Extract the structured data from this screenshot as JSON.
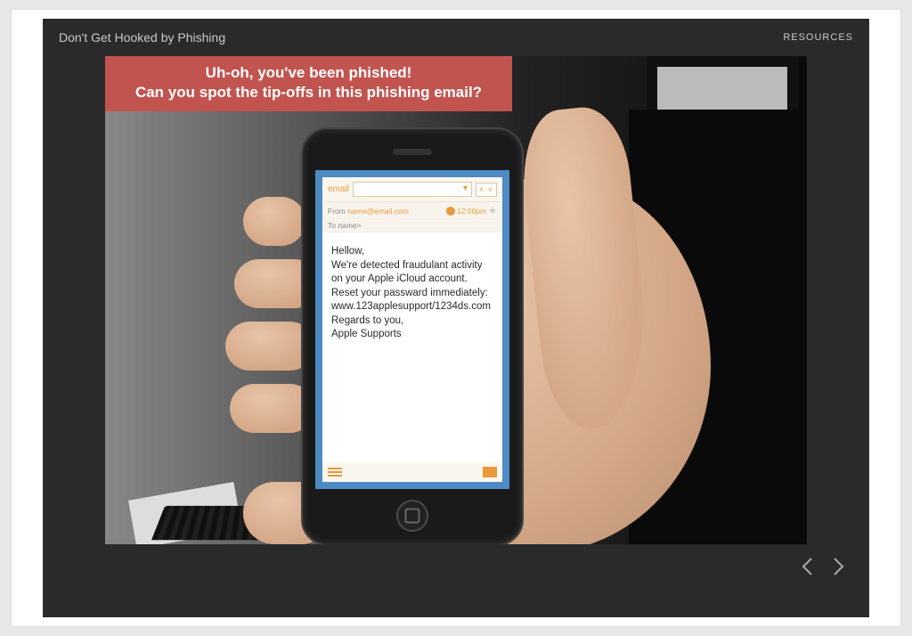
{
  "header": {
    "title": "Don't Get Hooked by Phishing",
    "resources_label": "RESOURCES"
  },
  "alert": {
    "line1": "Uh-oh, you've been phished!",
    "line2": "Can you spot the tip-offs in this phishing email?"
  },
  "email": {
    "app_label": "email",
    "arrows_label": "˄ ˅",
    "from_label": "From",
    "from_address": "name@email.com",
    "time": "12:00pm",
    "to_label": "To",
    "to_value": "name>",
    "body": "Hellow,\nWe're detected fraudulant activity on your Apple iCloud account. Reset your passward immediately: www.123applesupport/1234ds.com\nRegards to you,\nApple Supports"
  }
}
